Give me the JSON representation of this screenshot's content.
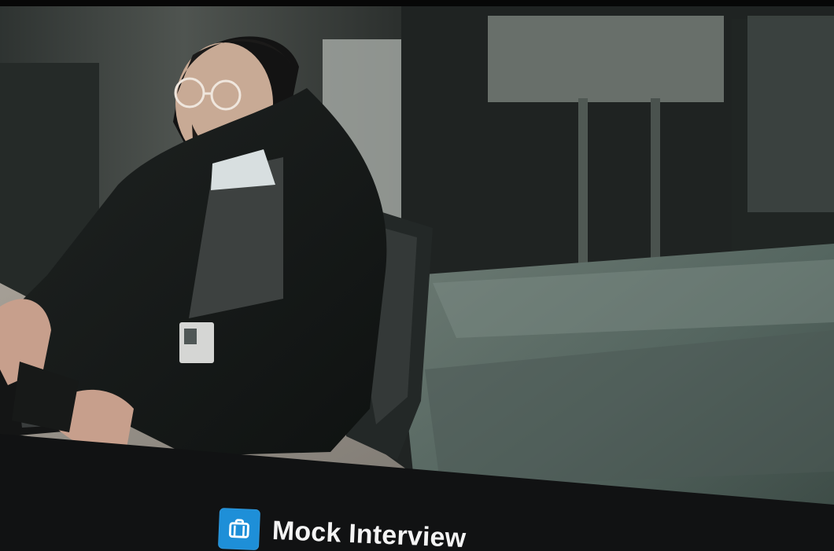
{
  "brand": {
    "title": "Mock Interview",
    "icon": "briefcase-icon",
    "accent_color": "#1e8fd8"
  },
  "hero": {
    "icon": "office-photo"
  }
}
